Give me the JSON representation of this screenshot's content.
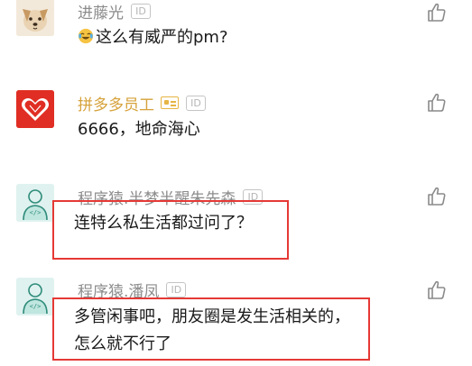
{
  "comments": [
    {
      "name": "进藤光",
      "id_badge": "ID",
      "text": "这么有威严的pm?",
      "emoji": "laughing-crying-emoji"
    },
    {
      "name": "拼多多员工",
      "id_badge": "ID",
      "text": "6666，地命海心"
    },
    {
      "name": "程序猿.半梦半醒朱先森",
      "id_badge": "ID",
      "text": "连特么私生活都过问了？"
    },
    {
      "name": "程序猿.潘凤",
      "id_badge": "ID",
      "text_line1": "多管闲事吧，朋友圈是发生活相关的，",
      "text_line2": "怎么就不行了"
    }
  ],
  "colors": {
    "name_gray": "#8c8c8c",
    "name_gold": "#d6a23b",
    "highlight_red": "#e53935",
    "pdd_red": "#e02e24"
  }
}
